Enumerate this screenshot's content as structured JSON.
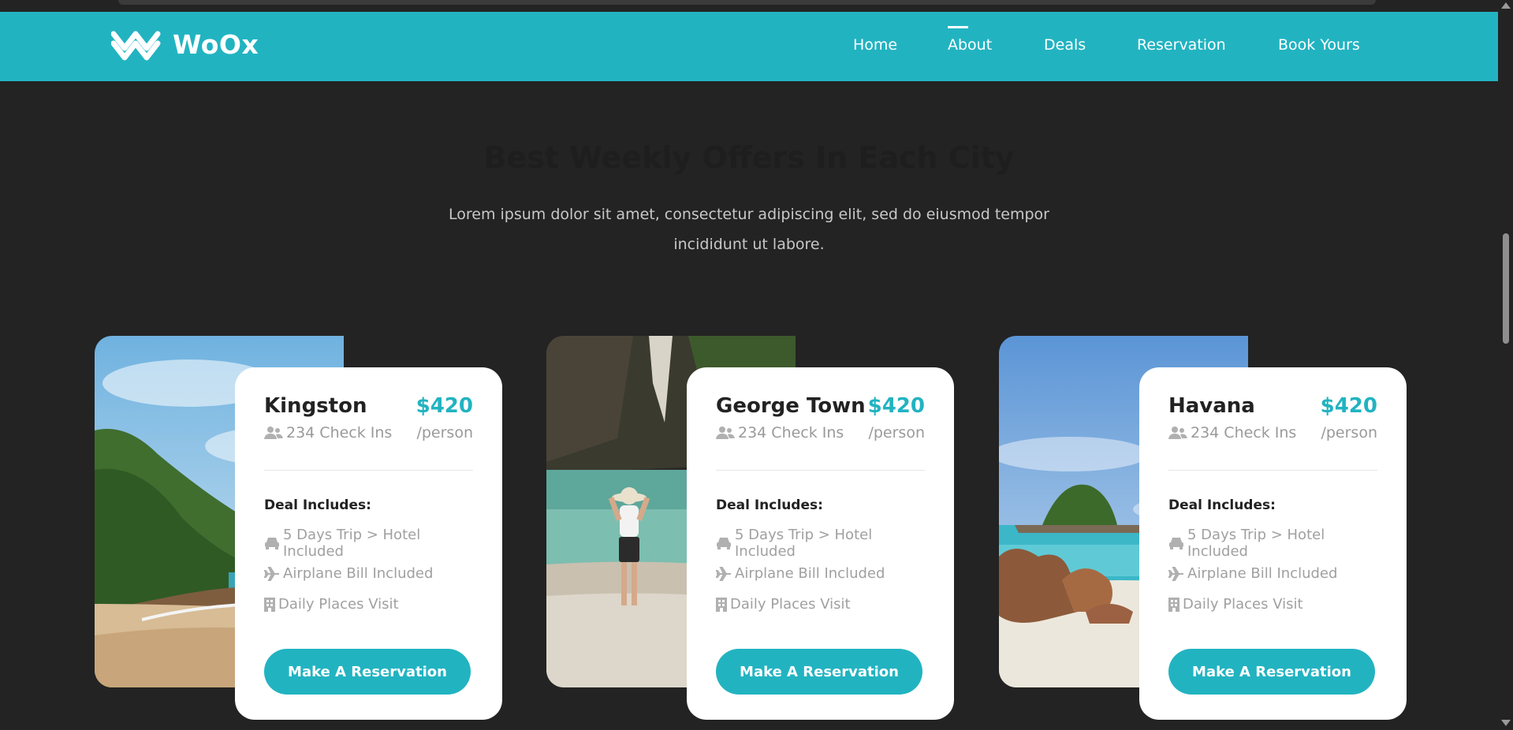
{
  "colors": {
    "accent": "#22b3c1",
    "background": "#232323",
    "card": "#ffffff"
  },
  "brand": {
    "name": "WoOx",
    "logo_icon": "woox-chevrons-logo"
  },
  "nav": {
    "items": [
      {
        "label": "Home",
        "active": false
      },
      {
        "label": "About",
        "active": true
      },
      {
        "label": "Deals",
        "active": false
      },
      {
        "label": "Reservation",
        "active": false
      },
      {
        "label": "Book Yours",
        "active": false
      }
    ]
  },
  "section": {
    "title": "Best Weekly Offers In Each City",
    "description_line1": "Lorem ipsum dolor sit amet, consectetur adipiscing elit, sed do eiusmod tempor",
    "description_line2": "incididunt ut labore."
  },
  "offers": [
    {
      "city": "Kingston",
      "price": "$420",
      "per": "/person",
      "checkins": "234 Check Ins",
      "deal_title": "Deal Includes:",
      "items": [
        "5 Days Trip > Hotel Included",
        "Airplane Bill Included",
        "Daily Places Visit"
      ],
      "button": "Make A Reservation",
      "image": "tropical-beach-cliff-photo"
    },
    {
      "city": "George Town",
      "price": "$420",
      "per": "/person",
      "checkins": "234 Check Ins",
      "deal_title": "Deal Includes:",
      "items": [
        "5 Days Trip > Hotel Included",
        "Airplane Bill Included",
        "Daily Places Visit"
      ],
      "button": "Make A Reservation",
      "image": "woman-on-lagoon-beach-photo"
    },
    {
      "city": "Havana",
      "price": "$420",
      "per": "/person",
      "checkins": "234 Check Ins",
      "deal_title": "Deal Includes:",
      "items": [
        "5 Days Trip > Hotel Included",
        "Airplane Bill Included",
        "Daily Places Visit"
      ],
      "button": "Make A Reservation",
      "image": "rocky-island-beach-photo"
    }
  ]
}
